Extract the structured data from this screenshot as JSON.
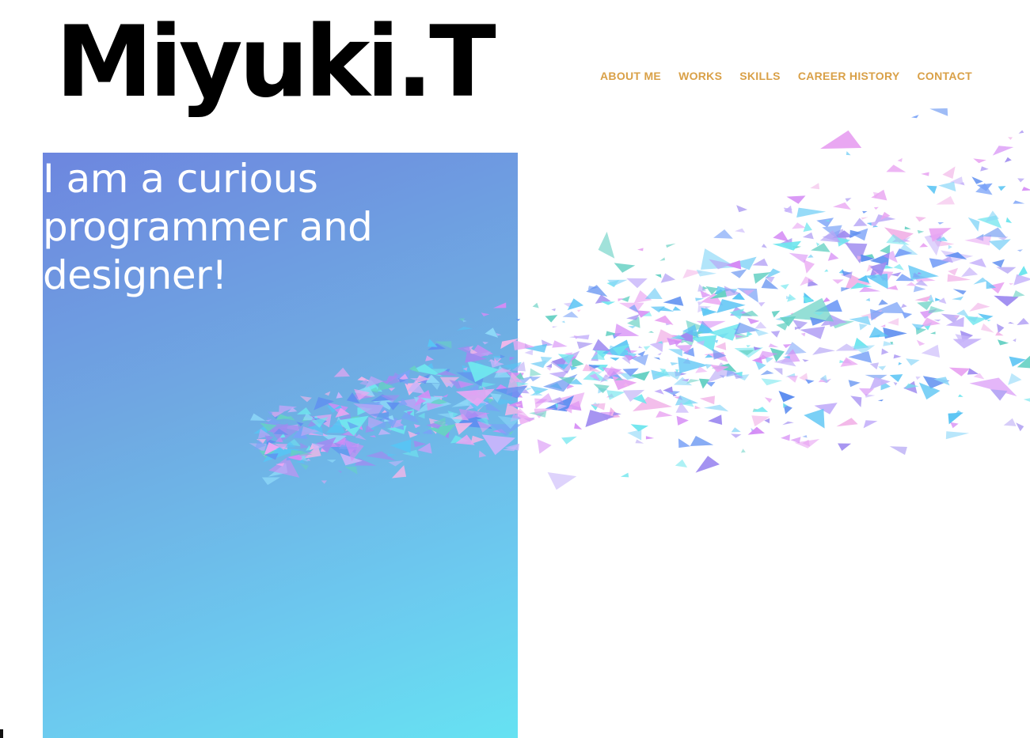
{
  "logo": {
    "text": "Miyuki.T"
  },
  "nav": {
    "items": [
      {
        "label": "ABOUT ME"
      },
      {
        "label": "WORKS"
      },
      {
        "label": "SKILLS"
      },
      {
        "label": "CAREER HISTORY"
      },
      {
        "label": "CONTACT"
      }
    ]
  },
  "hero": {
    "tagline": "I am a curious programmer and designer!"
  },
  "colors": {
    "nav_text": "#d9a047",
    "logo_text": "#000000",
    "panel_gradient_start": "#6d86df",
    "panel_gradient_end": "#66e2f2",
    "particle_palette": [
      "#b7a6f5",
      "#9f8cf0",
      "#7aa2f7",
      "#59c4f4",
      "#6fe6ee",
      "#e9a6f2",
      "#d58bf5",
      "#8ed8f8",
      "#c7b4fa",
      "#67d1c4",
      "#f2b6e8",
      "#5f8ff0"
    ]
  },
  "icons": {
    "particles": "triangle-particle-icon"
  }
}
